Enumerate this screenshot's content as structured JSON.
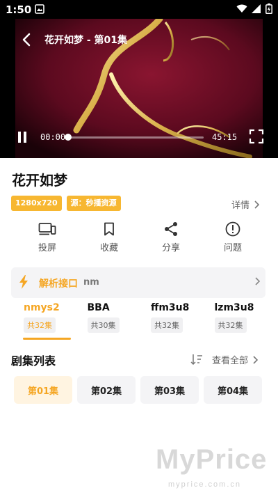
{
  "status_bar": {
    "time": "1:50"
  },
  "player": {
    "title": "花开如梦 - 第01集",
    "current_time": "00:00",
    "total_time": "45:15",
    "progress": 0.0
  },
  "show": {
    "title": "花开如梦",
    "badges": [
      "1280x720",
      "源：秒播资源"
    ],
    "detail_label": "详情"
  },
  "actions": [
    {
      "label": "投屏",
      "icon": "cast-icon"
    },
    {
      "label": "收藏",
      "icon": "bookmark-icon"
    },
    {
      "label": "分享",
      "icon": "share-icon"
    },
    {
      "label": "问题",
      "icon": "alert-icon"
    }
  ],
  "parse": {
    "label": "解析接口",
    "value": "nm"
  },
  "sources": [
    {
      "name": "nmys2",
      "count": "共32集",
      "active": true
    },
    {
      "name": "BBA",
      "count": "共30集",
      "active": false
    },
    {
      "name": "ffm3u8",
      "count": "共32集",
      "active": false
    },
    {
      "name": "lzm3u8",
      "count": "共32集",
      "active": false
    }
  ],
  "episodes_section": {
    "title": "剧集列表",
    "view_all": "查看全部"
  },
  "episodes": [
    "第01集",
    "第02集",
    "第03集",
    "第04集"
  ],
  "watermark": {
    "brand": "MyPrice",
    "url": "myprice.com.cn"
  },
  "colors": {
    "accent": "#f5a623",
    "badge": "#f7b731"
  }
}
